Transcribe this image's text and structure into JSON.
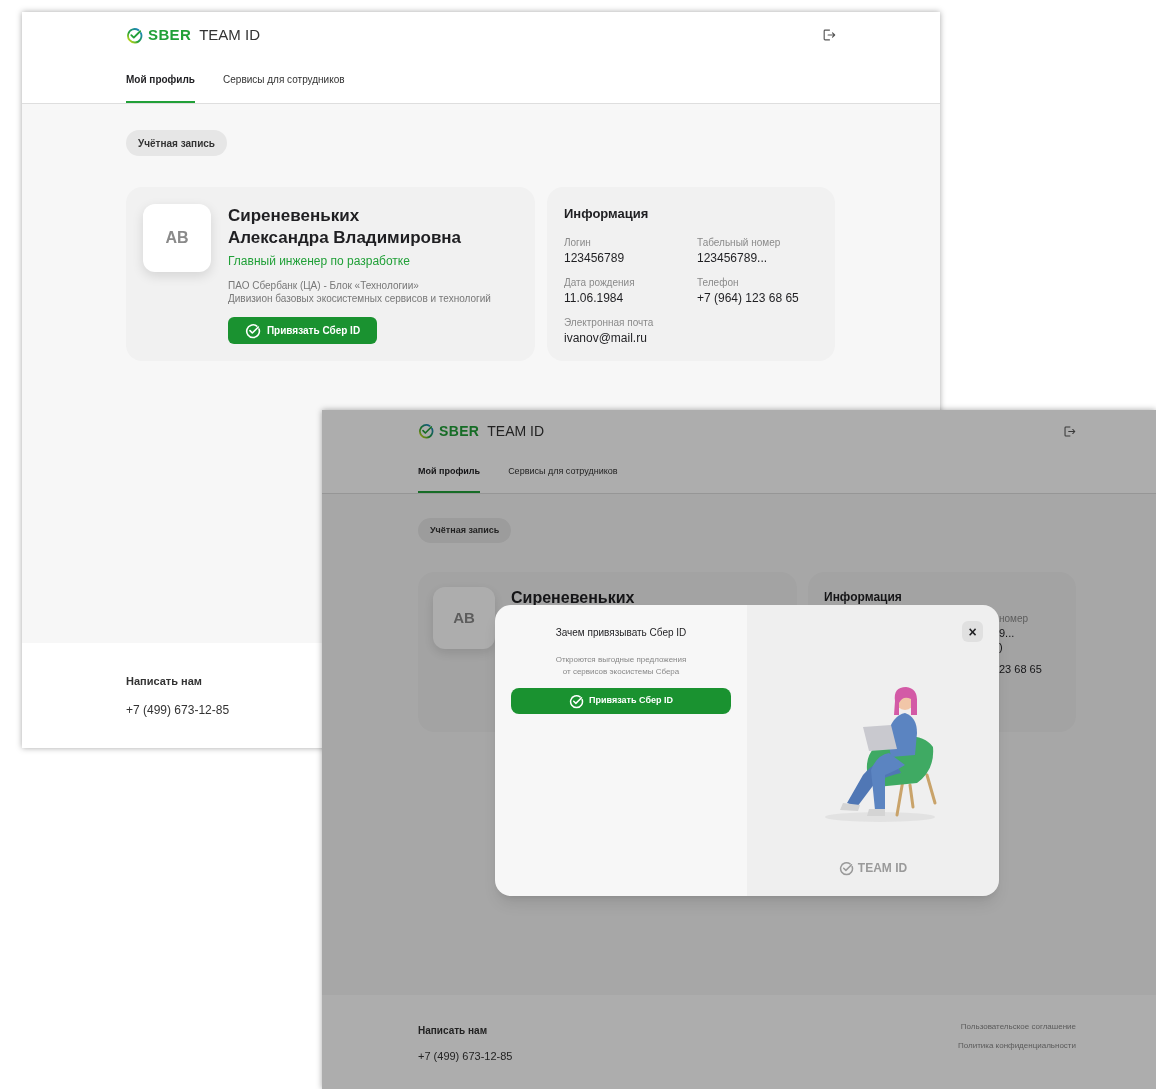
{
  "windows": [
    {
      "header": {
        "brand": "SBER",
        "product": "TEAM ID"
      },
      "tabs": [
        {
          "label": "Мой профиль",
          "selected": true
        },
        {
          "label": "Сервисы для сотрудников",
          "selected": false
        }
      ],
      "account_chip": "Учётная запись",
      "profile": {
        "avatar": "АВ",
        "name": "Сиреневеньких\nАлександра Владимировна",
        "position": "Главный инженер по разработке",
        "org_lines": [
          "ПАО Сбербанк (ЦА) - Блок «Технологии»",
          "Дивизион базовых экосистемных сервисов и технологий"
        ],
        "button": "Привязать Сбер ID"
      },
      "info": {
        "title": "Информация",
        "fields": [
          {
            "label": "Логин",
            "value": "123456789"
          },
          {
            "label": "Табельный номер",
            "value": "123456789..."
          },
          {
            "label": "Дата рождения",
            "value": "11.06.1984"
          },
          {
            "label": "Телефон",
            "value": "+7 (964) 123 68 65"
          },
          {
            "label": "Электронная почта",
            "value": "ivanov@mail.ru"
          }
        ]
      },
      "footer": {
        "contact_title": "Написать нам",
        "phone": "+7 (499) 673-12-85"
      }
    },
    {
      "header": {
        "brand": "SBER",
        "product": "TEAM ID"
      },
      "tabs": [
        {
          "label": "Мой профиль",
          "selected": true
        },
        {
          "label": "Сервисы для сотрудников",
          "selected": false
        }
      ],
      "account_chip": "Учётная запись",
      "profile": {
        "avatar": "АВ",
        "name": "Сиреневеньких"
      },
      "info": {
        "title": "Информация",
        "fragments": [
          "номер",
          "9...",
          ")",
          "23 68 65"
        ]
      },
      "footer": {
        "contact_title": "Написать нам",
        "phone": "+7 (499) 673-12-85",
        "links": [
          "Пользовательское соглашение",
          "Политика конфиденциальности"
        ]
      },
      "modal": {
        "title": "Зачем привязывать Сбер ID",
        "description": "Откроются выгодные предложения\nот сервисов экосистемы Сбера",
        "button": "Привязать Сбер ID",
        "close_label": "×",
        "logo": "TEAM ID"
      }
    }
  ]
}
